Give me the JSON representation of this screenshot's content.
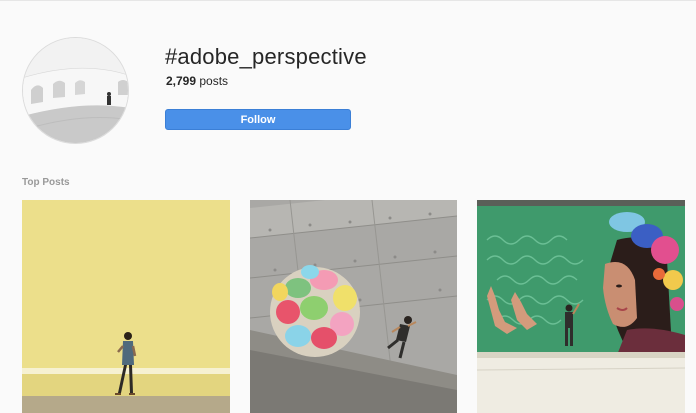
{
  "header": {
    "hashtag": "#adobe_perspective",
    "post_count": "2,799",
    "post_count_suffix": " posts",
    "follow_label": "Follow"
  },
  "top_posts": {
    "title": "Top Posts",
    "items": [
      {
        "subject": "man-on-phone-yellow-wall"
      },
      {
        "subject": "giant-colorful-stone-ball"
      },
      {
        "subject": "woman-chameleon-mural"
      }
    ]
  },
  "colors": {
    "follow_button": "#4a90e8",
    "background": "#fafafa",
    "section_title": "#999999"
  }
}
